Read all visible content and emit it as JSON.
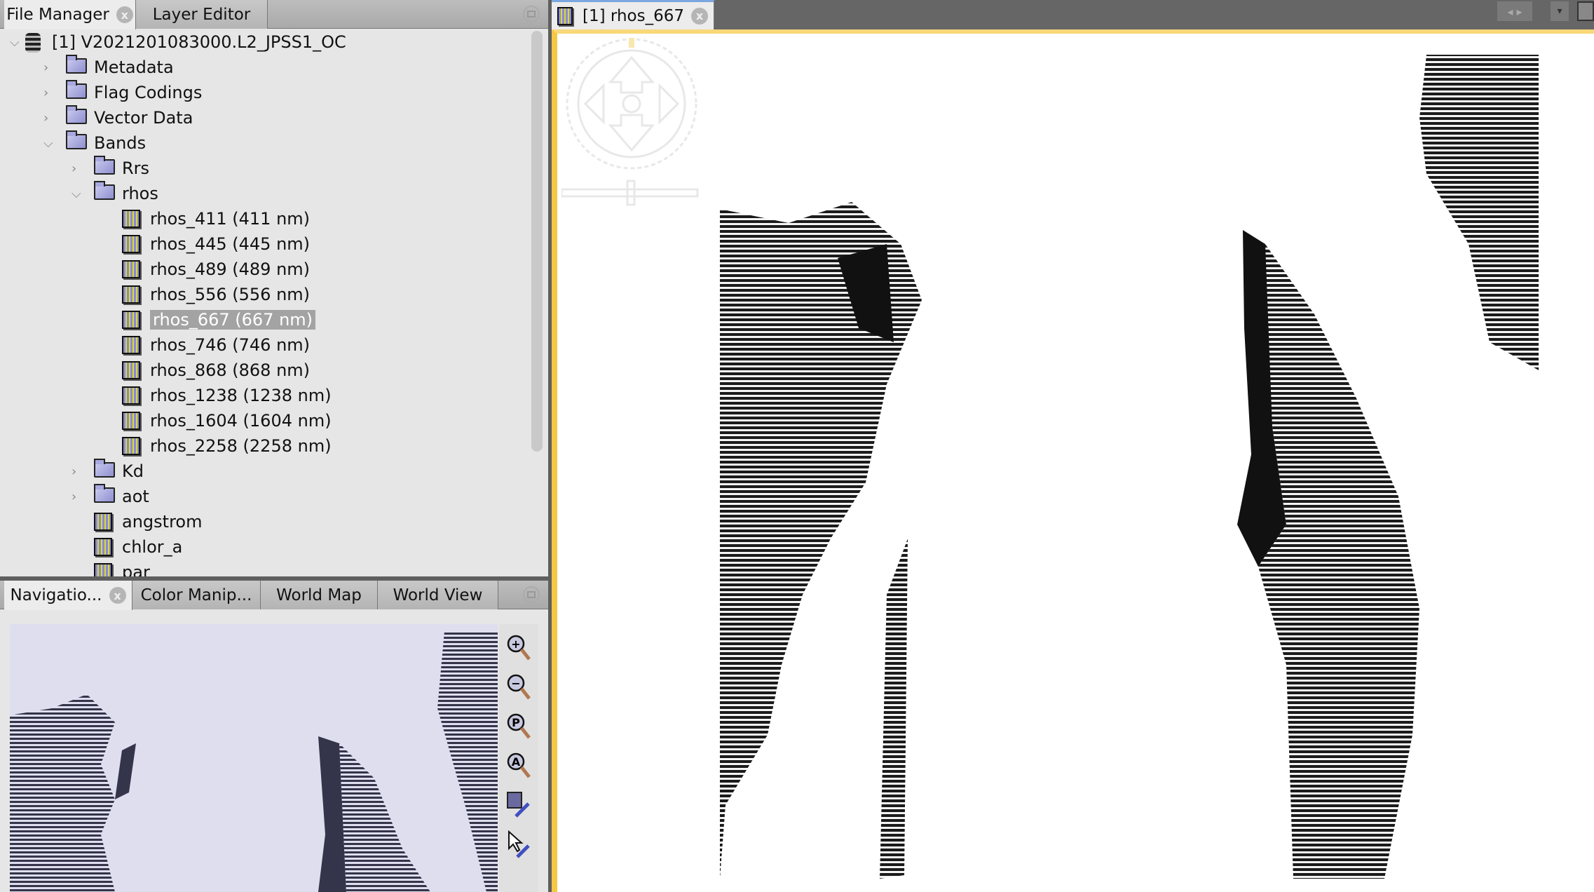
{
  "file_manager": {
    "tabs": [
      {
        "label": "File Manager",
        "active": true,
        "closable": true
      },
      {
        "label": "Layer Editor"
      }
    ],
    "tree": [
      {
        "label": "[1] V2021201083000.L2_JPSS1_OC",
        "level": 0,
        "icon": "database-icon",
        "expanded": true
      },
      {
        "label": "Metadata",
        "level": 1,
        "icon": "folder-icon",
        "expanded": false
      },
      {
        "label": "Flag Codings",
        "level": 1,
        "icon": "folder-icon",
        "expanded": false
      },
      {
        "label": "Vector Data",
        "level": 1,
        "icon": "folder-icon",
        "expanded": false
      },
      {
        "label": "Bands",
        "level": 1,
        "icon": "folder-icon",
        "expanded": true
      },
      {
        "label": "Rrs",
        "level": 2,
        "icon": "folder-icon",
        "expanded": false
      },
      {
        "label": "rhos",
        "level": 2,
        "icon": "folder-icon",
        "expanded": true
      },
      {
        "label": "rhos_411 (411 nm)",
        "level": 3,
        "icon": "band-icon"
      },
      {
        "label": "rhos_445 (445 nm)",
        "level": 3,
        "icon": "band-icon"
      },
      {
        "label": "rhos_489 (489 nm)",
        "level": 3,
        "icon": "band-icon"
      },
      {
        "label": "rhos_556 (556 nm)",
        "level": 3,
        "icon": "band-icon"
      },
      {
        "label": "rhos_667 (667 nm)",
        "level": 3,
        "icon": "band-icon",
        "selected": true
      },
      {
        "label": "rhos_746 (746 nm)",
        "level": 3,
        "icon": "band-icon"
      },
      {
        "label": "rhos_868 (868 nm)",
        "level": 3,
        "icon": "band-icon"
      },
      {
        "label": "rhos_1238 (1238 nm)",
        "level": 3,
        "icon": "band-icon"
      },
      {
        "label": "rhos_1604 (1604 nm)",
        "level": 3,
        "icon": "band-icon"
      },
      {
        "label": "rhos_2258 (2258 nm)",
        "level": 3,
        "icon": "band-icon"
      },
      {
        "label": "Kd",
        "level": 2,
        "icon": "folder-icon",
        "expanded": false
      },
      {
        "label": "aot",
        "level": 2,
        "icon": "folder-icon",
        "expanded": false
      },
      {
        "label": "angstrom",
        "level": 2,
        "icon": "band-icon"
      },
      {
        "label": "chlor_a",
        "level": 2,
        "icon": "band-icon"
      },
      {
        "label": "par",
        "level": 2,
        "icon": "band-icon"
      }
    ]
  },
  "tool_panel": {
    "tabs": [
      {
        "label": "Navigatio...",
        "active": true,
        "closable": true
      },
      {
        "label": "Color Manip..."
      },
      {
        "label": "World Map"
      },
      {
        "label": "World View"
      }
    ],
    "tools": [
      "zoom-in-icon",
      "zoom-out-icon",
      "zoom-pixel-icon",
      "zoom-all-icon",
      "sync-views-icon",
      "sync-cursor-icon"
    ]
  },
  "image_view": {
    "tab_label": "[1] rhos_667",
    "accent": "#f5c842"
  }
}
